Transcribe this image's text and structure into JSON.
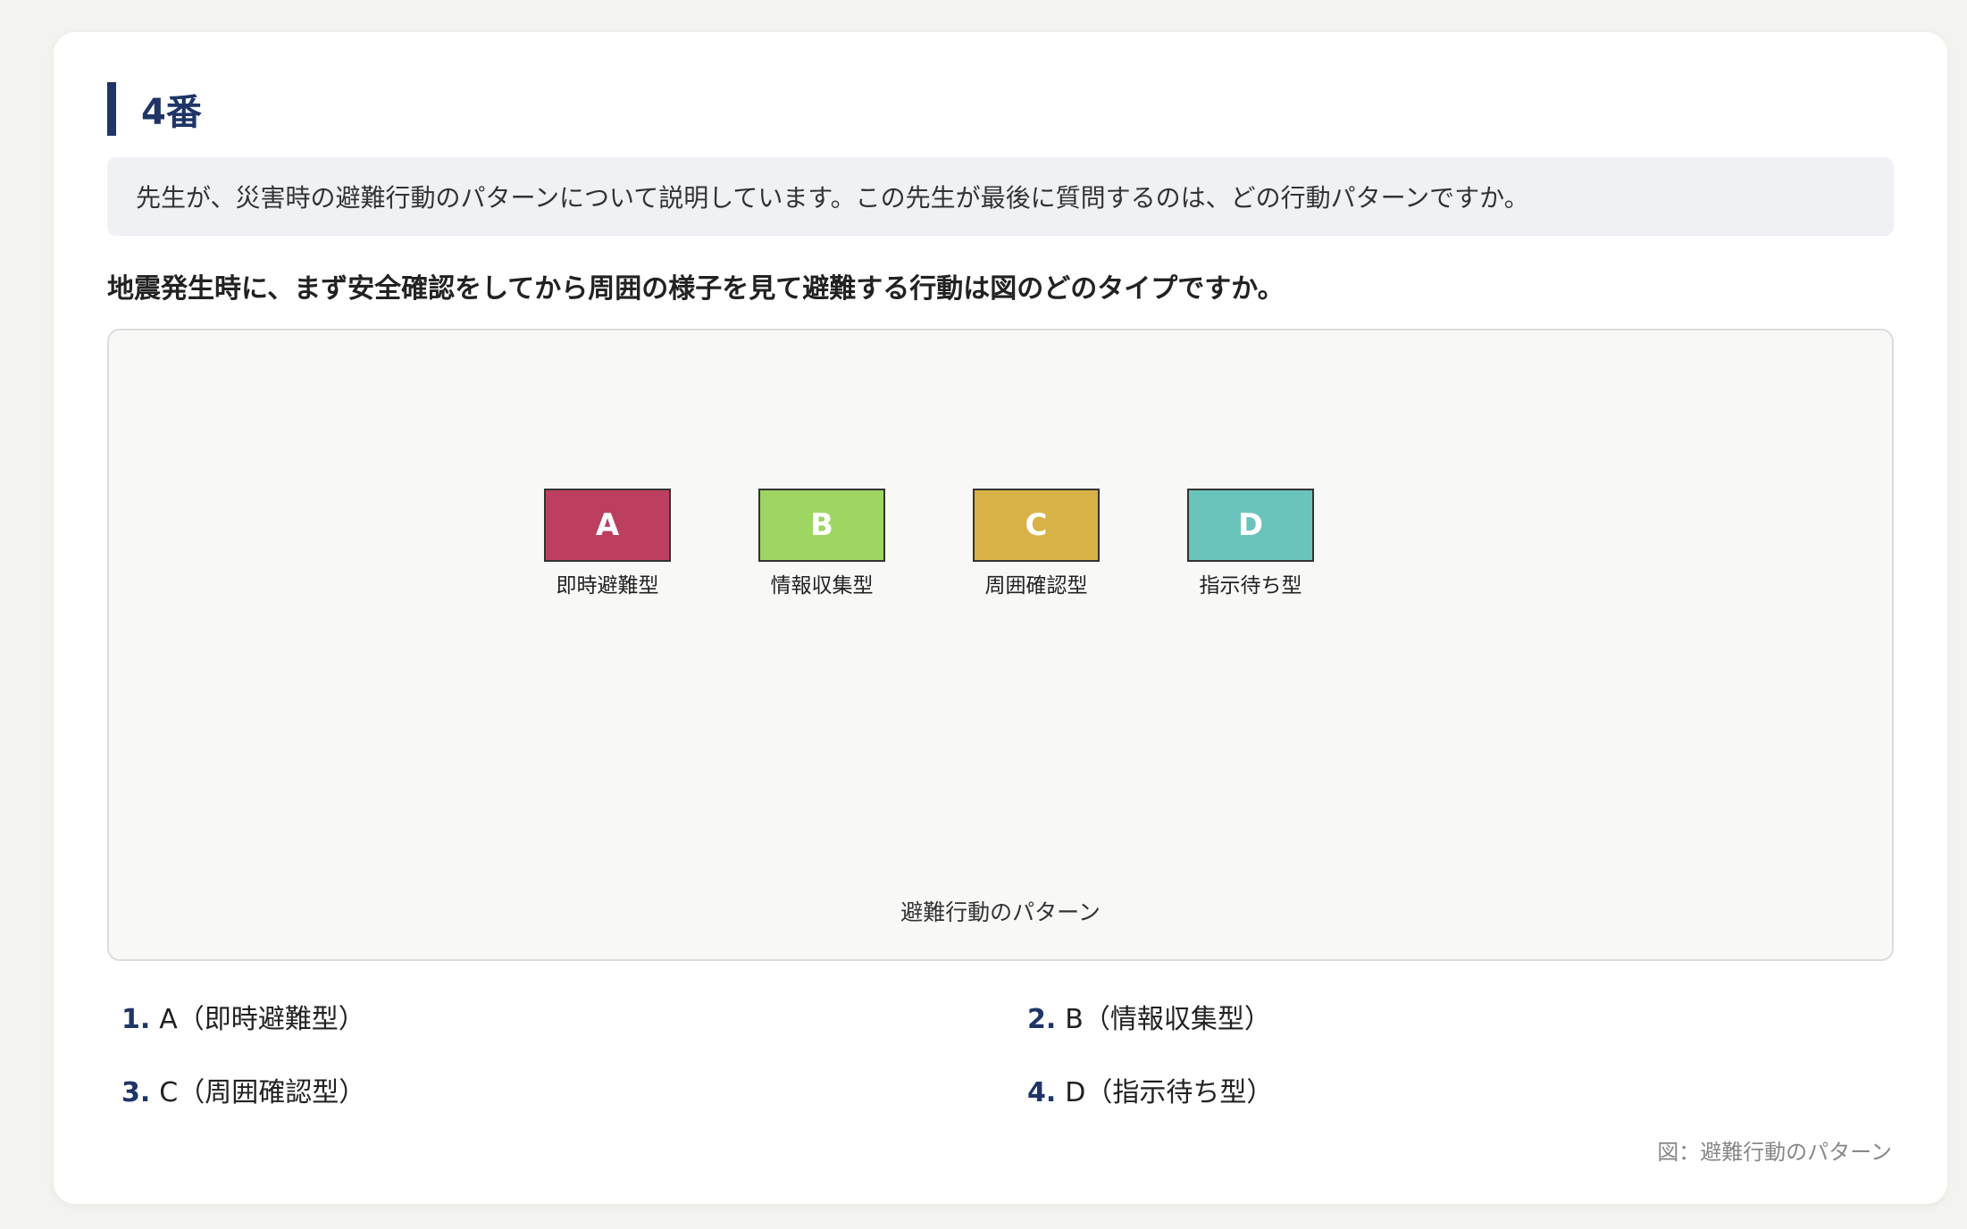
{
  "section": {
    "heading": "4番"
  },
  "instruction": "先生が、災害時の避難行動のパターンについて説明しています。この先生が最後に質問するのは、どの行動パターンですか。",
  "question": "地震発生時に、まず安全確認をしてから周囲の様子を見て避難する行動は図のどのタイプですか。",
  "figure": {
    "title": "避難行動のパターン",
    "boxes": [
      {
        "letter": "A",
        "label": "即時避難型",
        "color": "#bd3f5f"
      },
      {
        "letter": "B",
        "label": "情報収集型",
        "color": "#9ed563"
      },
      {
        "letter": "C",
        "label": "周囲確認型",
        "color": "#d9b247"
      },
      {
        "letter": "D",
        "label": "指示待ち型",
        "color": "#6ac4bc"
      }
    ]
  },
  "options": [
    {
      "num": "1.",
      "text": "A（即時避難型）"
    },
    {
      "num": "2.",
      "text": "B（情報収集型）"
    },
    {
      "num": "3.",
      "text": "C（周囲確認型）"
    },
    {
      "num": "4.",
      "text": "D（指示待ち型）"
    }
  ],
  "caption": "図：避難行動のパターン"
}
